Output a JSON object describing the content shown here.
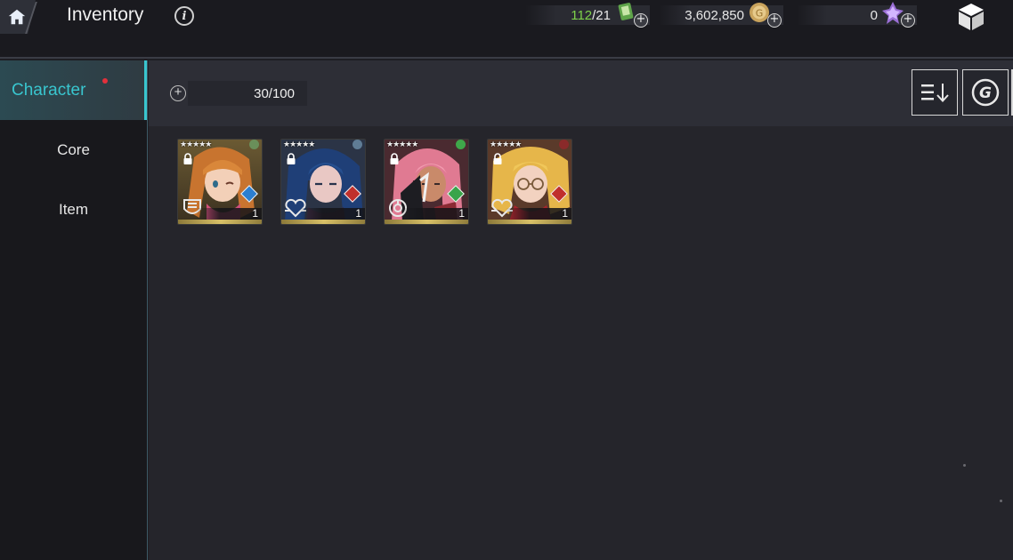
{
  "header": {
    "title": "Inventory",
    "info_icon": "info-icon",
    "home_icon": "home-icon"
  },
  "resources": {
    "stamina": {
      "current": "112",
      "separator_max": "/21",
      "icon": "stamina-card-icon"
    },
    "gold": {
      "value": "3,602,850",
      "icon": "gold-coin-icon"
    },
    "gems": {
      "value": "0",
      "icon": "purple-gem-icon"
    },
    "box_icon": "package-box-icon"
  },
  "sidebar": {
    "items": [
      {
        "label": "Character",
        "active": true,
        "has_notification": true
      },
      {
        "label": "Core",
        "active": false
      },
      {
        "label": "Item",
        "active": false
      }
    ]
  },
  "toolbar": {
    "capacity": "30/100",
    "sort_icon": "sort-descending-icon",
    "g_icon": "g-circle-icon"
  },
  "characters": [
    {
      "stars": "★★★★★",
      "quantity": "1",
      "element_color": "#6a8f5a",
      "type_color": "#2c7fd0",
      "class": "tank",
      "locked": true
    },
    {
      "stars": "★★★★★",
      "quantity": "1",
      "element_color": "#5f7c95",
      "type_color": "#c0302c",
      "class": "support",
      "locked": true
    },
    {
      "stars": "★★★★★",
      "quantity": "1",
      "element_color": "#3fa64a",
      "type_color": "#39a44a",
      "class": "attacker",
      "locked": true
    },
    {
      "stars": "★★★★★",
      "quantity": "1",
      "element_color": "#8a2a2a",
      "type_color": "#c0302c",
      "class": "support",
      "locked": true
    }
  ],
  "colors": {
    "accent": "#39c6cf",
    "stamina_current": "#7ed24a",
    "notification": "#e2303b"
  }
}
